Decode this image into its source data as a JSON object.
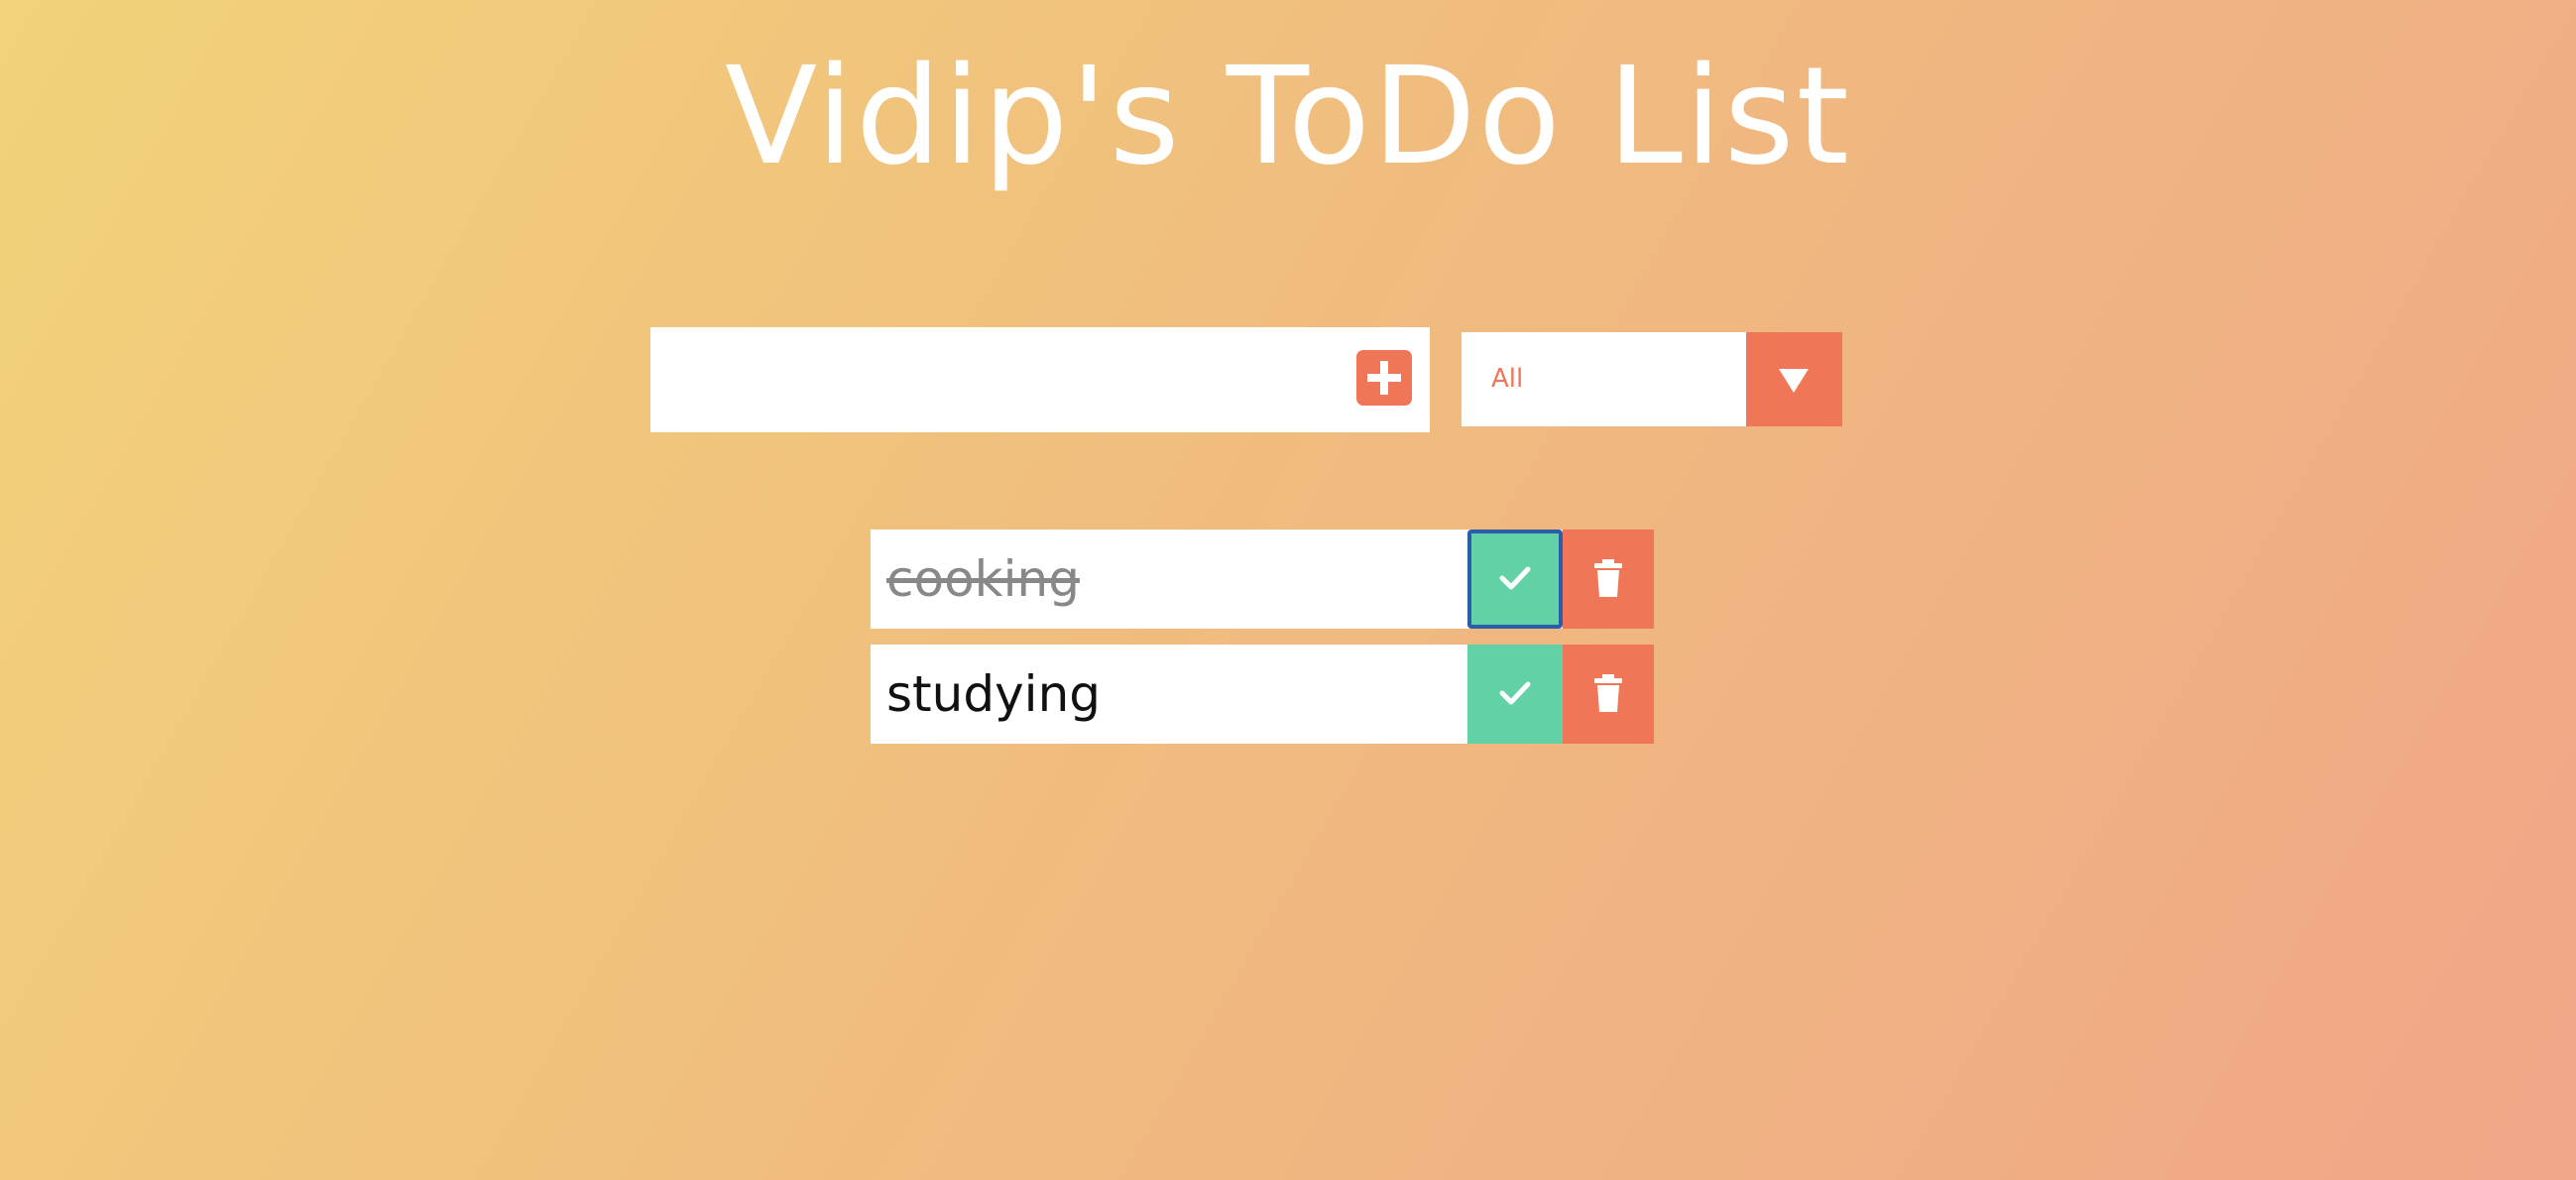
{
  "header": {
    "title": "Vidip's ToDo List"
  },
  "form": {
    "input_value": "",
    "add_icon": "plus-icon",
    "filter": {
      "selected": "All",
      "caret_icon": "caret-down-icon"
    }
  },
  "todos": [
    {
      "text": "cooking",
      "completed": true,
      "check_icon": "check-icon",
      "delete_icon": "trash-icon"
    },
    {
      "text": "studying",
      "completed": false,
      "check_icon": "check-icon",
      "delete_icon": "trash-icon"
    }
  ],
  "colors": {
    "accent": "#ef7656",
    "complete": "#62d1a5",
    "focus_ring": "#2a5ea8",
    "gradient_start": "#f2d27a",
    "gradient_end": "#f0a688"
  }
}
